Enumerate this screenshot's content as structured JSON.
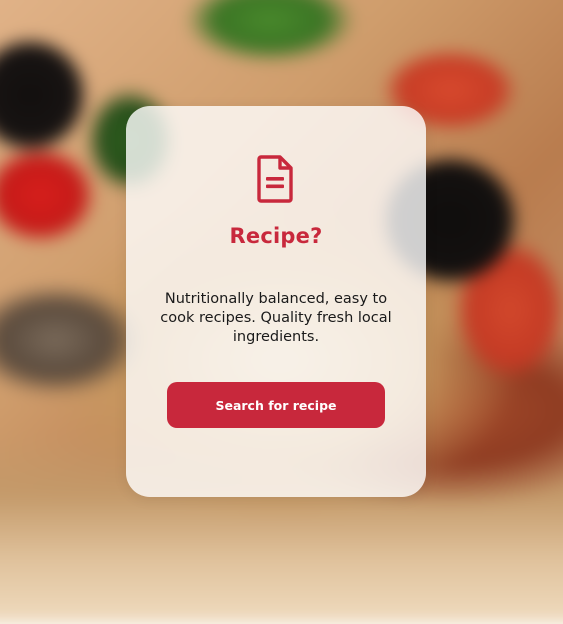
{
  "background": {
    "image": "blurred-pizza-photo"
  },
  "card": {
    "icon": "document-icon",
    "title": "Recipe?",
    "description": "Nutritionally balanced, easy to cook recipes. Quality fresh local ingredients.",
    "button_label": "Search for recipe"
  },
  "colors": {
    "accent": "#c8283c",
    "card_background": "rgba(255,255,255,0.8)",
    "text": "#1a1a1a",
    "button_text": "#ffffff"
  }
}
